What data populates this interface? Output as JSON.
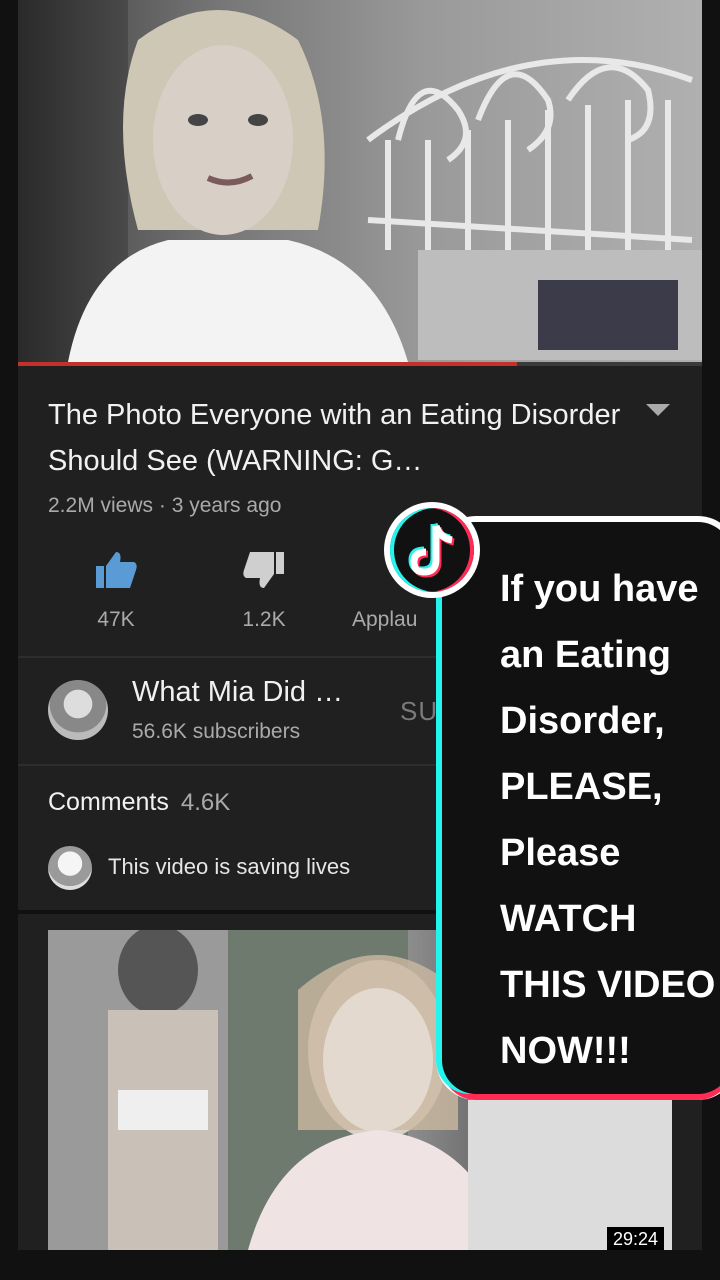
{
  "video": {
    "title": "The Photo Everyone with an Eating Disorder Should See (WARNING: G…",
    "meta": "2.2M views · 3 years ago",
    "progress_fraction": 0.73
  },
  "actions": {
    "like_count": "47K",
    "dislike_count": "1.2K",
    "applaud_label": "Applau"
  },
  "channel": {
    "name": "What Mia Did …",
    "subscribers": "56.6K subscribers",
    "subscribe_label": "SU"
  },
  "comments": {
    "label": "Comments",
    "count": "4.6K",
    "top_comment": "This video is saving lives"
  },
  "next_video": {
    "duration": "29:24"
  },
  "overlay": {
    "lines": [
      "If you have",
      "an Eating",
      "Disorder,",
      "PLEASE,",
      "Please",
      "WATCH",
      "THIS VIDEO",
      "NOW!!!"
    ]
  },
  "colors": {
    "accent_cyan": "#25f4ee",
    "accent_red": "#fe2c55",
    "progress_red": "#c4302b"
  },
  "icons": [
    "like-icon",
    "dislike-icon",
    "expand-chevron-icon",
    "tiktok-logo-icon"
  ]
}
